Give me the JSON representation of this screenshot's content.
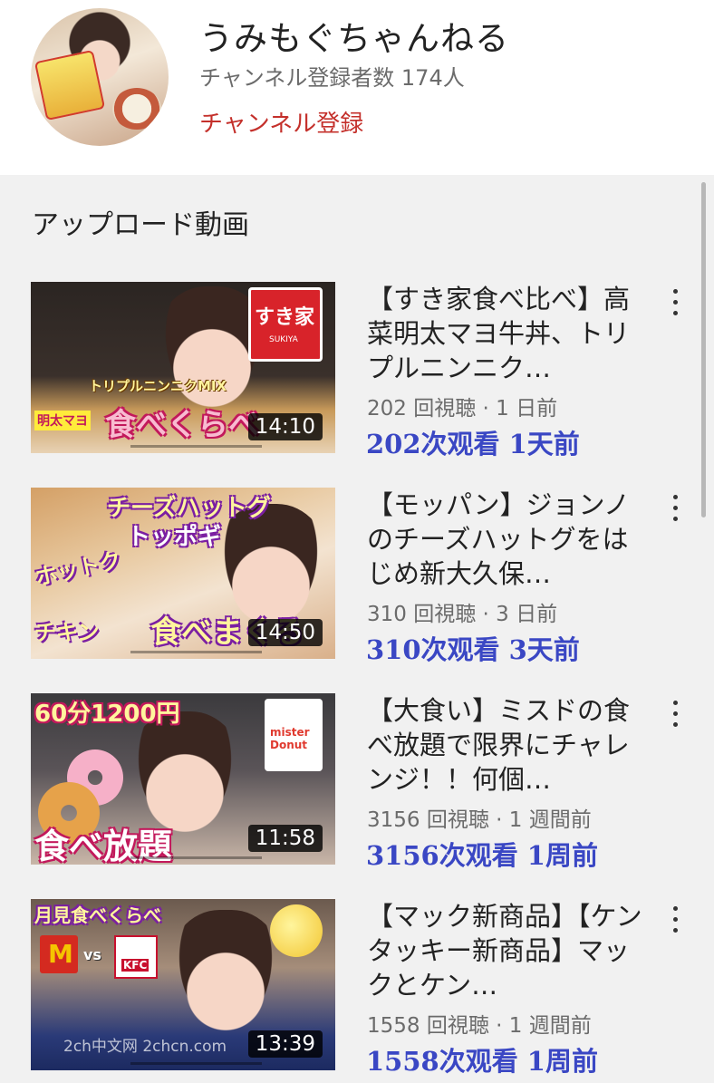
{
  "header": {
    "channel_name": "うみもぐちゃんねる",
    "subscribers": "チャンネル登録者数 174人",
    "subscribe_label": "チャンネル登録"
  },
  "section": {
    "title": "アップロード動画"
  },
  "videos": [
    {
      "title": "【すき家食べ比べ】高菜明太マヨ牛丼、トリプルニンニク…",
      "meta": "202 回視聴 · 1 日前",
      "zh": "202次观看 1天前",
      "duration": "14:10",
      "thumb_text": "食べくらべ",
      "thumb_text2": "トリプルニンニクMIX",
      "thumb_text3": "明太マヨ",
      "logo_text": "すき家",
      "logo_sub": "SUKIYA"
    },
    {
      "title": "【モッパン】ジョンノのチーズハットグをはじめ新大久保…",
      "meta": "310 回視聴 · 3 日前",
      "zh": "310次观看 3天前",
      "duration": "14:50",
      "thumb_text": "チーズハットグ",
      "thumb_text2": "トッポギ",
      "thumb_text3": "ホットク",
      "thumb_text4": "チキン",
      "thumb_text5": "食べまくる"
    },
    {
      "title": "【大食い】ミスドの食べ放題で限界にチャレンジ！！何個…",
      "meta": "3156 回視聴 · 1 週間前",
      "zh": "3156次观看 1周前",
      "duration": "11:58",
      "thumb_text": "60分1200円",
      "thumb_text2": "食べ放題",
      "logo_text": "mister Donut"
    },
    {
      "title": "【マック新商品】【ケンタッキー新商品】マックとケン…",
      "meta": "1558 回視聴 · 1 週間前",
      "zh": "1558次观看 1周前",
      "duration": "13:39",
      "thumb_text": "月見食べくらべ",
      "thumb_text2": "vs",
      "logo_text": "M",
      "logo_text2": "KFC"
    }
  ],
  "watermark": "2ch中文网 2chcn.com",
  "colors": {
    "accent_red": "#c4302b",
    "zh_blue": "#3a47c4",
    "background_gray": "#f1f1f1"
  }
}
